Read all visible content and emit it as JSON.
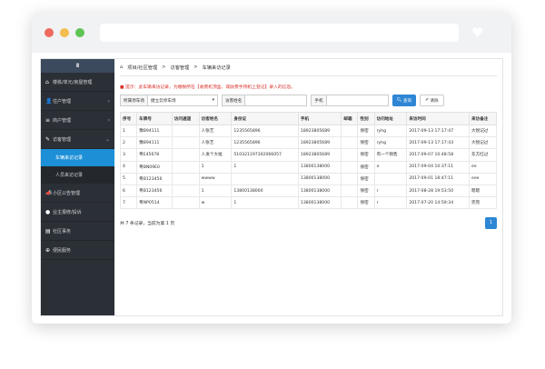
{
  "sidebar": {
    "top_icon": "Ⅲ",
    "items": [
      {
        "icon": "⌂",
        "label": "楼栋/单元/房屋管理"
      },
      {
        "icon": "👤",
        "label": "住户管理",
        "arrow": "›"
      },
      {
        "icon": "≡",
        "label": "商户管理",
        "arrow": "›"
      },
      {
        "icon": "✎",
        "label": "访客管理",
        "arrow": "⌄"
      }
    ],
    "subitems": [
      {
        "label": "车辆来访记录",
        "active": true
      },
      {
        "label": "人员来访记录",
        "active": false
      }
    ],
    "items2": [
      {
        "icon": "📣",
        "label": "小区公告管理"
      },
      {
        "icon": "●",
        "label": "业主报修/投诉"
      },
      {
        "icon": "▤",
        "label": "社区事务"
      },
      {
        "icon": "⊕",
        "label": "便民服务"
      }
    ]
  },
  "breadcrumb": {
    "icon": "⌂",
    "items": [
      "项目/社区管理",
      ">",
      "访客管理",
      ">",
      "车辆来访记录"
    ]
  },
  "tip": "■ 提示：此车辆来访记录，为缴税所在【收费机顶盒、或收费手持机上登记】录入的信息。",
  "filters": {
    "community_label": "所属停车场",
    "community_value": "捷立云停车场",
    "name_label": "访客姓名",
    "phone_label": "手机",
    "query_btn": "查询",
    "clear_btn": "清除"
  },
  "table": {
    "headers": [
      "序号",
      "车牌号",
      "访问通道",
      "访客姓名",
      "身份证",
      "手机",
      "邮箱",
      "性别",
      "访问地址",
      "来访时间",
      "来访备注"
    ],
    "rows": [
      [
        "1",
        "豫B94111",
        "",
        "人张艺",
        "1235565896",
        "18923805689",
        "",
        "保密",
        "ryhg",
        "2017-09-13 17:17:47",
        "大锐记过"
      ],
      [
        "2",
        "豫B94111",
        "",
        "人张艺",
        "1235565896",
        "18923805689",
        "",
        "保密",
        "ryhg",
        "2017-09-13 17:17:43",
        "大锐记过"
      ],
      [
        "3",
        "粤E45678",
        "",
        "人发个大福",
        "510321197302066057",
        "18923805689",
        "",
        "保密",
        "有一个销售",
        "2017-09-07 10:48:58",
        "东方红过"
      ],
      [
        "4",
        "粤BN09E0",
        "",
        "1",
        "1",
        "13800138000",
        "",
        "保密",
        "e",
        "2017-09-04 10:37:11",
        "ee"
      ],
      [
        "5",
        "粤B123456",
        "",
        "wwww",
        "",
        "13800138000",
        "",
        "保密",
        "",
        "2017-09-01 18:47:11",
        "eee"
      ],
      [
        "6",
        "粤B123456",
        "",
        "1",
        "13800138000",
        "13800138000",
        "",
        "保密",
        "r",
        "2017-08-28 19:53:50",
        "嗯嗯"
      ],
      [
        "7",
        "粤NP0514",
        "",
        "w",
        "1",
        "13800138000",
        "",
        "保密",
        "r",
        "2017-07-20 14:59:34",
        "完完"
      ]
    ]
  },
  "footer": {
    "summary": "共 7 条记录，当前为第 1 页",
    "page": "1"
  }
}
